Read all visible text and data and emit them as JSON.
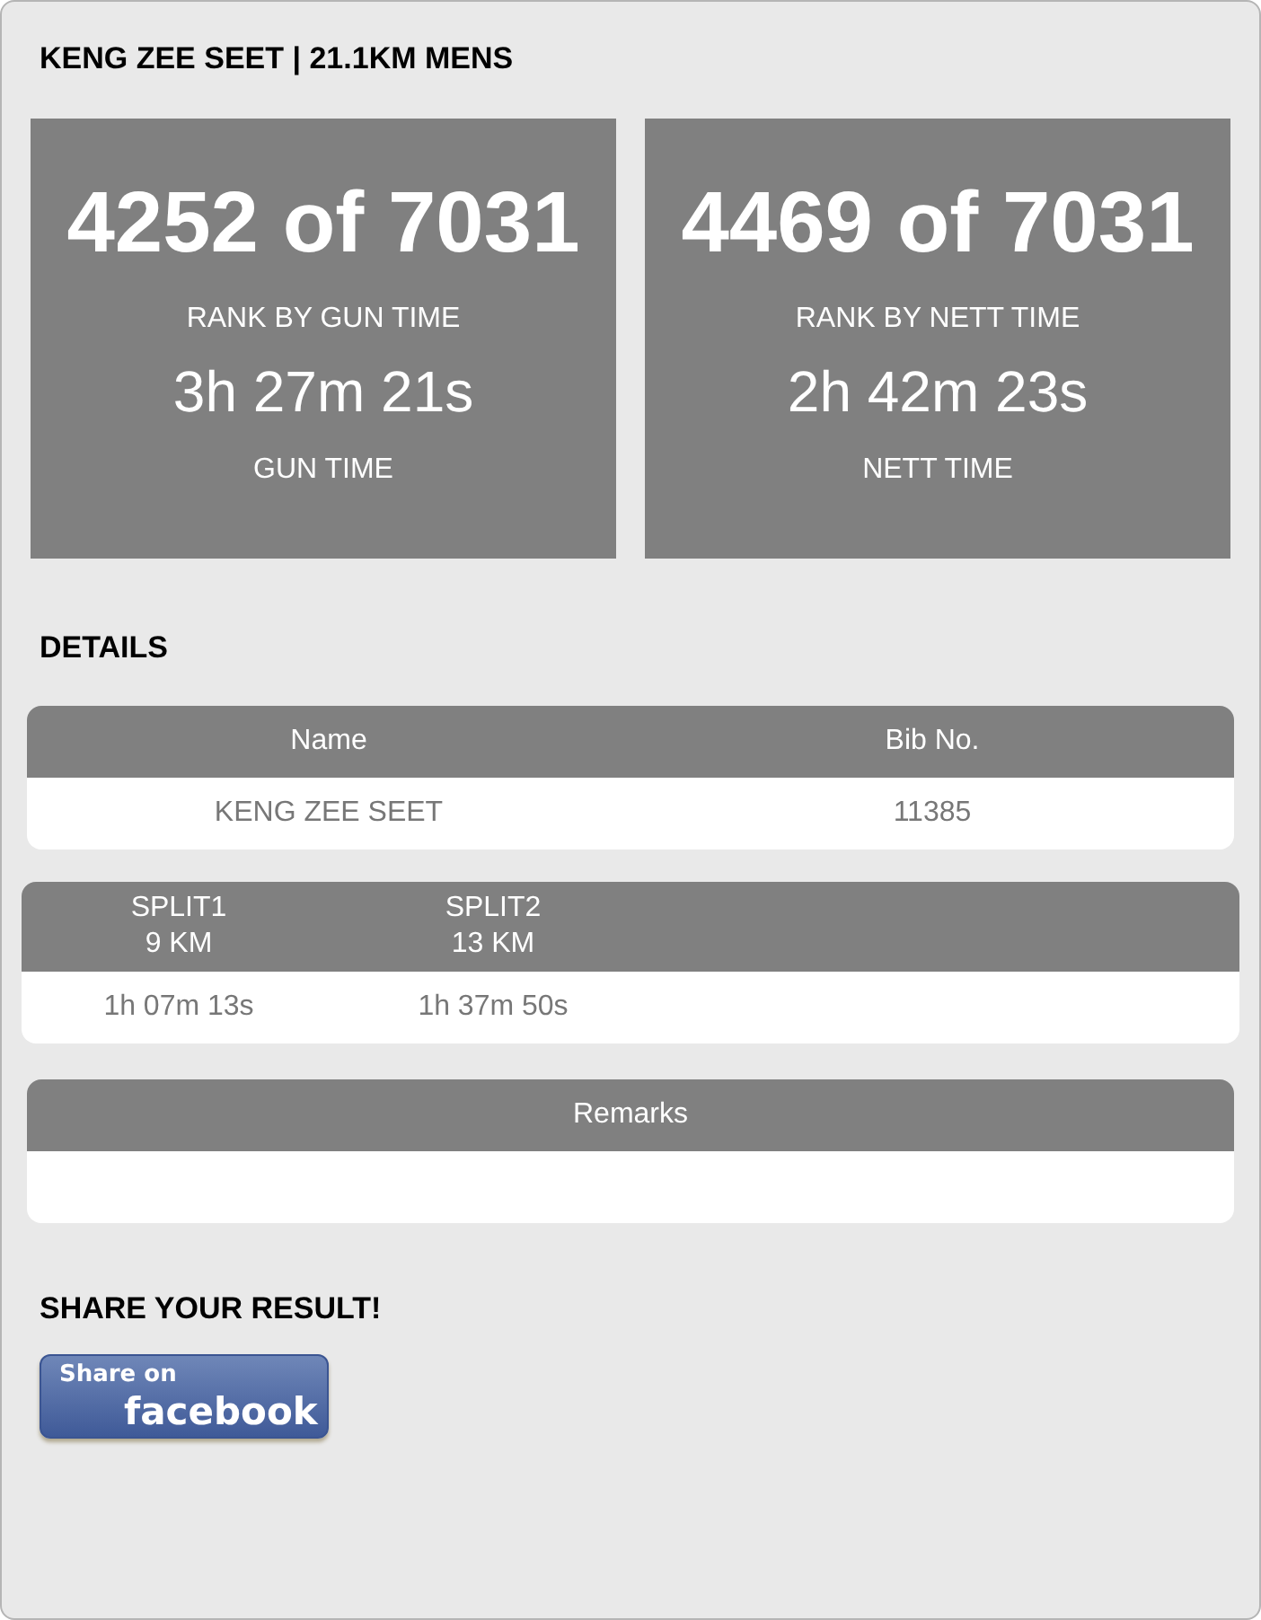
{
  "title": "KENG ZEE SEET | 21.1KM MENS",
  "rank_cards": [
    {
      "rank": "4252 of 7031",
      "rank_label": "RANK BY GUN TIME",
      "time": "3h 27m 21s",
      "time_label": "GUN TIME"
    },
    {
      "rank": "4469 of 7031",
      "rank_label": "RANK BY NETT TIME",
      "time": "2h 42m 23s",
      "time_label": "NETT TIME"
    }
  ],
  "details": {
    "heading": "DETAILS",
    "columns": [
      "Name",
      "Bib No."
    ],
    "row": [
      "KENG ZEE SEET",
      "11385"
    ]
  },
  "splits": {
    "columns": [
      {
        "name": "SPLIT1",
        "distance": "9 KM"
      },
      {
        "name": "SPLIT2",
        "distance": "13 KM"
      }
    ],
    "values": [
      "1h 07m 13s",
      "1h 37m 50s"
    ]
  },
  "remarks": {
    "heading": "Remarks"
  },
  "share": {
    "heading": "SHARE YOUR RESULT!",
    "button": {
      "line_1": "Share on",
      "line_2": "facebook"
    }
  }
}
